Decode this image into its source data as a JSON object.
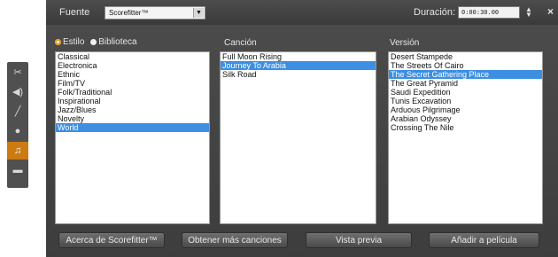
{
  "header": {
    "font_label": "Fuente",
    "font_select_value": "Scorefitter™",
    "duration_label": "Duración:",
    "duration_value": "0:00:30.00"
  },
  "toolbar": {
    "icons": [
      "scissors-icon",
      "speaker-icon",
      "wand-icon",
      "disc-icon",
      "music-note-icon",
      "camera-icon"
    ]
  },
  "filters": {
    "style_label": "Estilo",
    "library_label": "Biblioteca",
    "selected": "Estilo"
  },
  "columns": {
    "song_title": "Canción",
    "version_title": "Versión"
  },
  "styles": [
    "Classical",
    "Electronica",
    "Ethnic",
    "Film/TV",
    "Folk/Traditional",
    "Inspirational",
    "Jazz/Blues",
    "Novelty",
    "World"
  ],
  "styles_selected": "World",
  "songs": [
    "Full Moon Rising",
    "Journey To Arabia",
    "Silk Road"
  ],
  "songs_selected": "Journey To Arabia",
  "versions": [
    "Desert Stampede",
    "The Streets Of Cairo",
    "The Secret Gathering Place",
    "The Great Pyramid",
    "Saudi Expedition",
    "Tunis Excavation",
    "Arduous Pilgrimage",
    "Arabian Odyssey",
    "Crossing The Nile"
  ],
  "versions_selected": "The Secret Gathering Place",
  "buttons": {
    "about": "Acerca de Scorefitter™",
    "get_more": "Obtener más canciones",
    "preview": "Vista previa",
    "add_to_movie": "Añadir a película"
  },
  "colors": {
    "accent_active": "#cc7a12",
    "selection": "#3c8fe2"
  }
}
